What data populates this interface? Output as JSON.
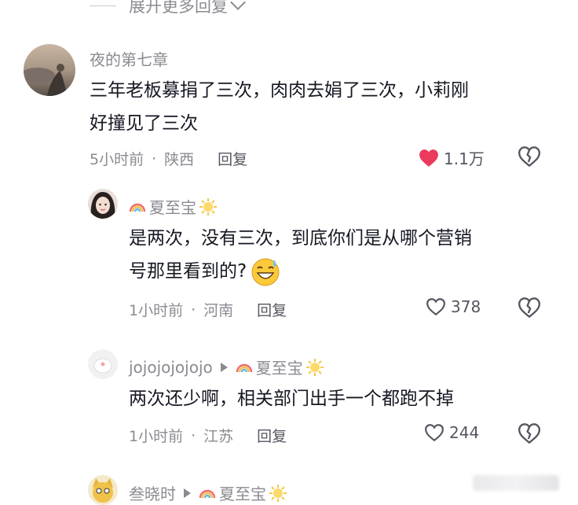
{
  "expand": {
    "label": "展开更多回复"
  },
  "comments": [
    {
      "username": "夜的第七章",
      "text_line1": "三年老板募捐了三次，肉肉去娟了三次，小莉刚",
      "text_line2": "好撞见了三次",
      "time": "5小时前",
      "location": "陕西",
      "reply_label": "回复",
      "likes": "1.1万",
      "liked": true
    }
  ],
  "replies": [
    {
      "username": "夏至宝",
      "text_line1": "是两次，没有三次，到底你们是从哪个营销",
      "text_line2": "号那里看到的?",
      "time": "1小时前",
      "location": "河南",
      "reply_label": "回复",
      "likes": "378"
    },
    {
      "username": "jojojojojojo",
      "reply_to": "夏至宝",
      "text": "两次还少啊，相关部门出手一个都跑不掉",
      "time": "1小时前",
      "location": "江苏",
      "reply_label": "回复",
      "likes": "244"
    },
    {
      "username": "叁晓时",
      "reply_to": "夏至宝"
    }
  ],
  "colors": {
    "like_red": "#ea3a5d",
    "meta_gray": "#8a8b91",
    "text": "#161823"
  }
}
